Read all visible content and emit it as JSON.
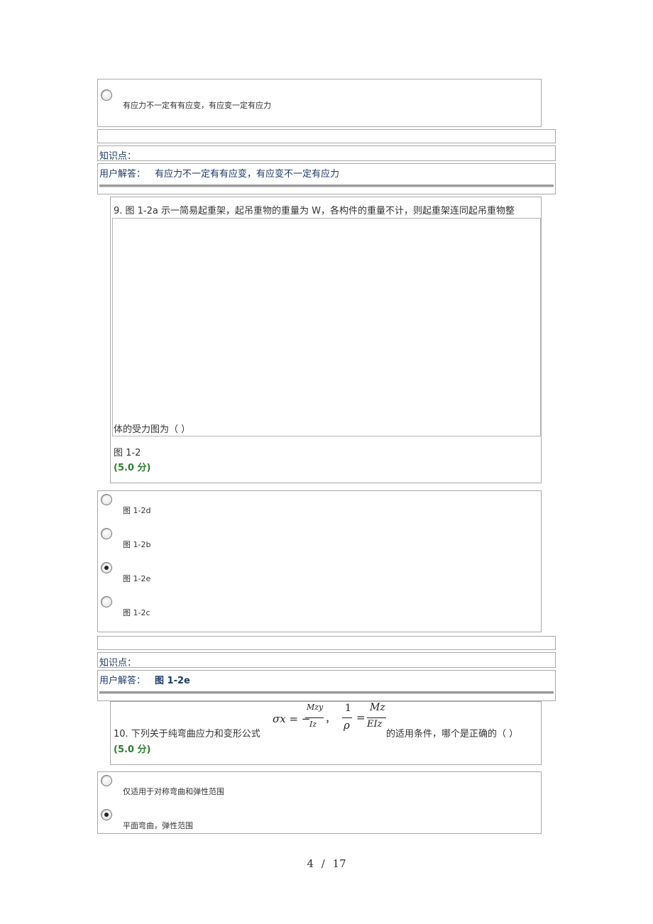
{
  "q8": {
    "option_text": "有应力不一定有有应变，有应变一定有应力",
    "knowledge_label": "知识点：",
    "user_answer_label": "用户解答：",
    "user_answer_value": "有应力不一定有有应变，有应变不一定有应力"
  },
  "q9": {
    "text_line1": "9. 图 1-2a 示一简易起重架，起吊重物的重量为 W，各构件的重量不计，则起重架连同起吊重物整",
    "text_line2": "体的受力图为（    ）",
    "figure_caption": "图  1-2",
    "score": "(5.0  分)",
    "options": [
      {
        "label": "图 1-2d",
        "checked": false
      },
      {
        "label": "图 1-2b",
        "checked": false
      },
      {
        "label": "图 1-2e",
        "checked": true
      },
      {
        "label": "图 1-2c",
        "checked": false
      }
    ],
    "knowledge_label": "知识点：",
    "user_answer_label": "用户解答：",
    "user_answer_value": "图 1-2e"
  },
  "q10": {
    "text_before": "10. 下列关于纯弯曲应力和变形公式",
    "text_after": "的适用条件，哪个是正确的（    ）",
    "formula": {
      "lhs1": "σx = −",
      "num1": "Mzy",
      "den1": "Iz",
      "sep": "，",
      "num2": "1",
      "den2": "ρ",
      "eq2": "=",
      "num3": "Mz",
      "den3": "EIz"
    },
    "score": "(5.0  分)",
    "options": [
      {
        "label": "仅适用于对称弯曲和弹性范围",
        "checked": false
      },
      {
        "label": "平面弯曲，弹性范围",
        "checked": true
      }
    ]
  },
  "page": {
    "current": "4",
    "separator": "/",
    "total": "17"
  }
}
